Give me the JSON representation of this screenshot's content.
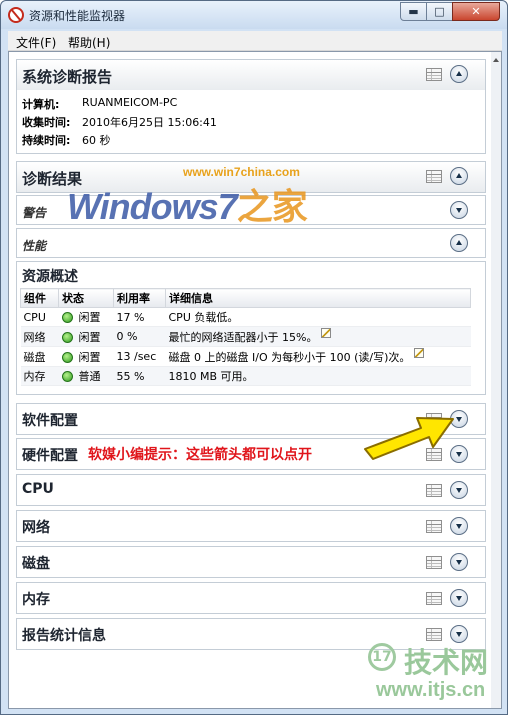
{
  "window": {
    "title": "资源和性能监视器"
  },
  "menu": {
    "file": "文件(F)",
    "help": "帮助(H)"
  },
  "report": {
    "title": "系统诊断报告",
    "rows": [
      {
        "label": "计算机:",
        "value": "RUANMEICOM-PC"
      },
      {
        "label": "收集时间:",
        "value": "2010年6月25日  15:06:41"
      },
      {
        "label": "持续时间:",
        "value": "60 秒"
      }
    ]
  },
  "diagnosis": {
    "title": "诊断结果"
  },
  "warning": {
    "title": "警告"
  },
  "performance": {
    "title": "性能"
  },
  "resource": {
    "title": "资源概述",
    "headers": [
      "组件",
      "状态",
      "利用率",
      "详细信息"
    ],
    "rows": [
      {
        "component": "CPU",
        "status": "闲置",
        "usage": "17 %",
        "details": "CPU 负载低。",
        "edit": false
      },
      {
        "component": "网络",
        "status": "闲置",
        "usage": "0 %",
        "details": "最忙的网络适配器小于 15%。",
        "edit": true
      },
      {
        "component": "磁盘",
        "status": "闲置",
        "usage": "13 /sec",
        "details": "磁盘 0 上的磁盘 I/O 为每秒小于 100 (读/写)次。",
        "edit": true
      },
      {
        "component": "内存",
        "status": "普通",
        "usage": "55 %",
        "details": "1810 MB 可用。",
        "edit": false
      }
    ]
  },
  "collapsed_sections": [
    "软件配置",
    "硬件配置",
    "CPU",
    "网络",
    "磁盘",
    "内存",
    "报告统计信息"
  ],
  "overlays": {
    "watermark_url": "www.win7china.com",
    "watermark_brand": "Windows7",
    "watermark_brand_suffix": "之家",
    "note": "软媒小编提示：这些箭头都可以点开",
    "site_logo": "17",
    "site_name": "技术网",
    "site_url": "www.itjs.cn"
  },
  "colors": {
    "note": "#e0151b",
    "arrow_fill": "#ffe600",
    "status_ok": "#2e9a1d"
  }
}
